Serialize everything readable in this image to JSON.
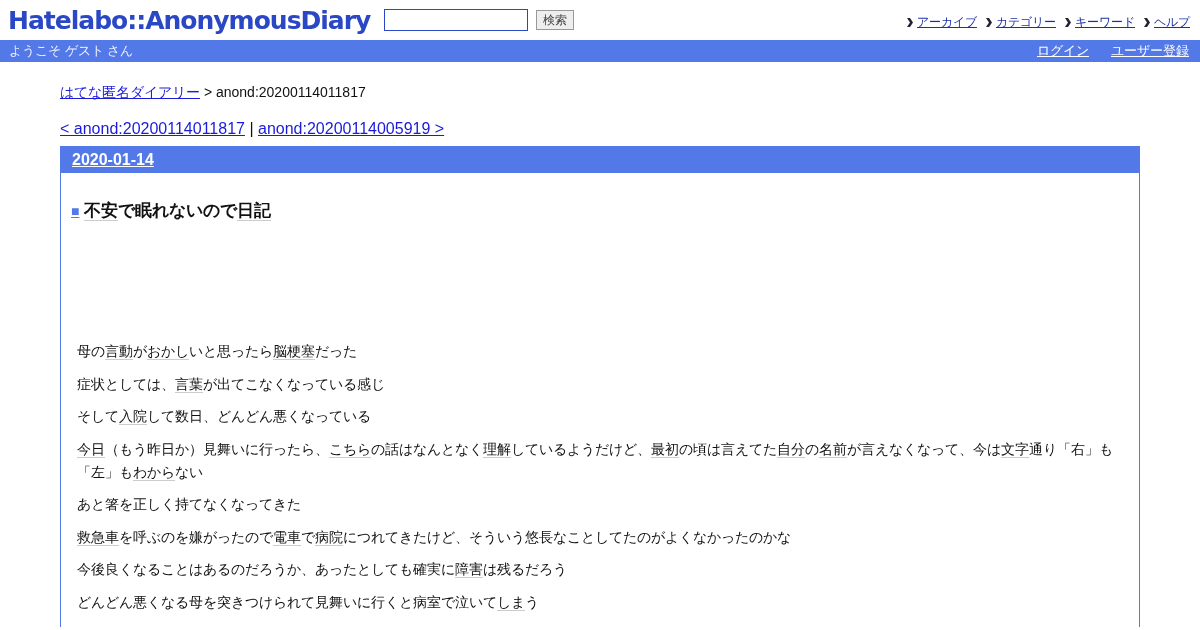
{
  "header": {
    "logo": "Hatelabo::AnonymousDiary",
    "search": {
      "button": "検索"
    },
    "nav": [
      "アーカイブ",
      "カテゴリー",
      "キーワード",
      "ヘルプ"
    ]
  },
  "welcome_bar": {
    "greeting": "ようこそ ゲスト さん",
    "links": [
      "ログイン",
      "ユーザー登録"
    ]
  },
  "breadcrumb": {
    "home": "はてな匿名ダイアリー",
    "current": "> anond:20200114011817"
  },
  "pager": {
    "prev": "< anond:20200114011817",
    "separator": "|",
    "next": "anond:20200114005919 >"
  },
  "day": {
    "date": "2020-01-14",
    "entry": {
      "marker": "■",
      "title": [
        {
          "text": "不安",
          "kind": "keyword"
        },
        {
          "text": "で眠れないので",
          "kind": "text"
        },
        {
          "text": "日記",
          "kind": "keyword"
        }
      ],
      "paragraphs": [
        [
          {
            "text": "母の",
            "kind": "text"
          },
          {
            "text": "言動",
            "kind": "keyword"
          },
          {
            "text": "が",
            "kind": "text"
          },
          {
            "text": "おかし",
            "kind": "keyword"
          },
          {
            "text": "いと思ったら",
            "kind": "text"
          },
          {
            "text": "脳梗塞",
            "kind": "keyword"
          },
          {
            "text": "だった",
            "kind": "text"
          }
        ],
        [
          {
            "text": "症状としては、",
            "kind": "text"
          },
          {
            "text": "言葉",
            "kind": "keyword"
          },
          {
            "text": "が出てこなくなっている感じ",
            "kind": "text"
          }
        ],
        [
          {
            "text": "そして",
            "kind": "text"
          },
          {
            "text": "入院",
            "kind": "keyword"
          },
          {
            "text": "して数日、どんどん悪くなっている",
            "kind": "text"
          }
        ],
        [
          {
            "text": "今日",
            "kind": "keyword"
          },
          {
            "text": "（もう昨日か）見舞いに行ったら、",
            "kind": "text"
          },
          {
            "text": "こちら",
            "kind": "keyword"
          },
          {
            "text": "の話はなんとなく",
            "kind": "text"
          },
          {
            "text": "理解",
            "kind": "keyword"
          },
          {
            "text": "しているようだけど、",
            "kind": "text"
          },
          {
            "text": "最初",
            "kind": "keyword"
          },
          {
            "text": "の頃は言えてた",
            "kind": "text"
          },
          {
            "text": "自分",
            "kind": "keyword"
          },
          {
            "text": "の",
            "kind": "text"
          },
          {
            "text": "名前",
            "kind": "keyword"
          },
          {
            "text": "が言えなくなって、今は",
            "kind": "text"
          },
          {
            "text": "文字",
            "kind": "keyword"
          },
          {
            "text": "通り「右」も「左」も",
            "kind": "text"
          },
          {
            "text": "わから",
            "kind": "keyword"
          },
          {
            "text": "ない",
            "kind": "text"
          }
        ],
        [
          {
            "text": "あと箸を正しく持てなくなってきた",
            "kind": "text"
          }
        ],
        [
          {
            "text": "救急車",
            "kind": "keyword"
          },
          {
            "text": "を呼ぶのを嫌がったので",
            "kind": "text"
          },
          {
            "text": "電車",
            "kind": "keyword"
          },
          {
            "text": "で",
            "kind": "text"
          },
          {
            "text": "病院",
            "kind": "keyword"
          },
          {
            "text": "につれてきたけど、そういう悠長なことしてたのがよくなかったのかな",
            "kind": "text"
          }
        ],
        [
          {
            "text": "今後良くなることはあるのだろうか、あったとしても確実に",
            "kind": "text"
          },
          {
            "text": "障害",
            "kind": "keyword"
          },
          {
            "text": "は残るだろう",
            "kind": "text"
          }
        ],
        [
          {
            "text": "どんどん悪くなる母を突きつけられて見舞いに行くと病室で泣いて",
            "kind": "text"
          },
          {
            "text": "しま",
            "kind": "keyword"
          },
          {
            "text": "う",
            "kind": "text"
          }
        ]
      ]
    }
  }
}
